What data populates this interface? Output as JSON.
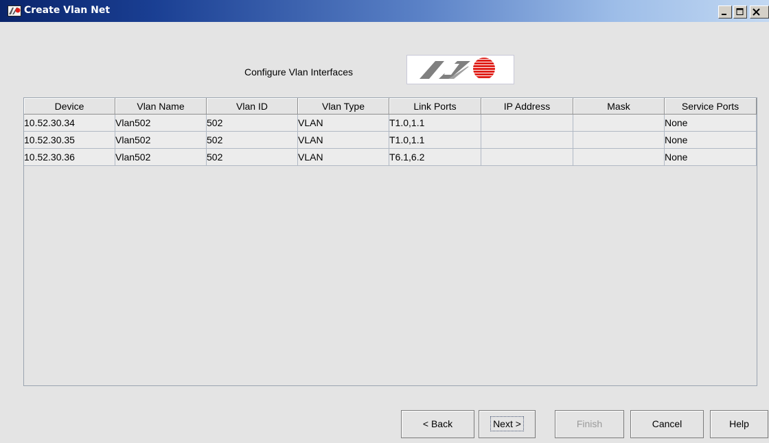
{
  "window": {
    "title": "Create Vlan Net",
    "controls": [
      "minimize-icon",
      "maximize-icon",
      "close-icon"
    ],
    "title_bar_color": "#0a246a"
  },
  "header": {
    "label": "Configure Vlan Interfaces",
    "logo_icon": "allied-telesis-logo",
    "logo_colors": [
      "#808080",
      "#e0201a"
    ]
  },
  "table": {
    "columns": [
      "Device",
      "Vlan Name",
      "Vlan ID",
      "Vlan Type",
      "Link Ports",
      "IP Address",
      "Mask",
      "Service Ports"
    ],
    "rows": [
      [
        "10.52.30.34",
        "Vlan502",
        "502",
        "VLAN",
        "T1.0,1.1",
        "",
        "",
        "None"
      ],
      [
        "10.52.30.35",
        "Vlan502",
        "502",
        "VLAN",
        "T1.0,1.1",
        "",
        "",
        "None"
      ],
      [
        "10.52.30.36",
        "Vlan502",
        "502",
        "VLAN",
        "T6.1,6.2",
        "",
        "",
        "None"
      ]
    ]
  },
  "buttons": {
    "back": "< Back",
    "next": "Next >",
    "finish": "Finish",
    "cancel": "Cancel",
    "help": "Help",
    "finish_disabled": true
  }
}
